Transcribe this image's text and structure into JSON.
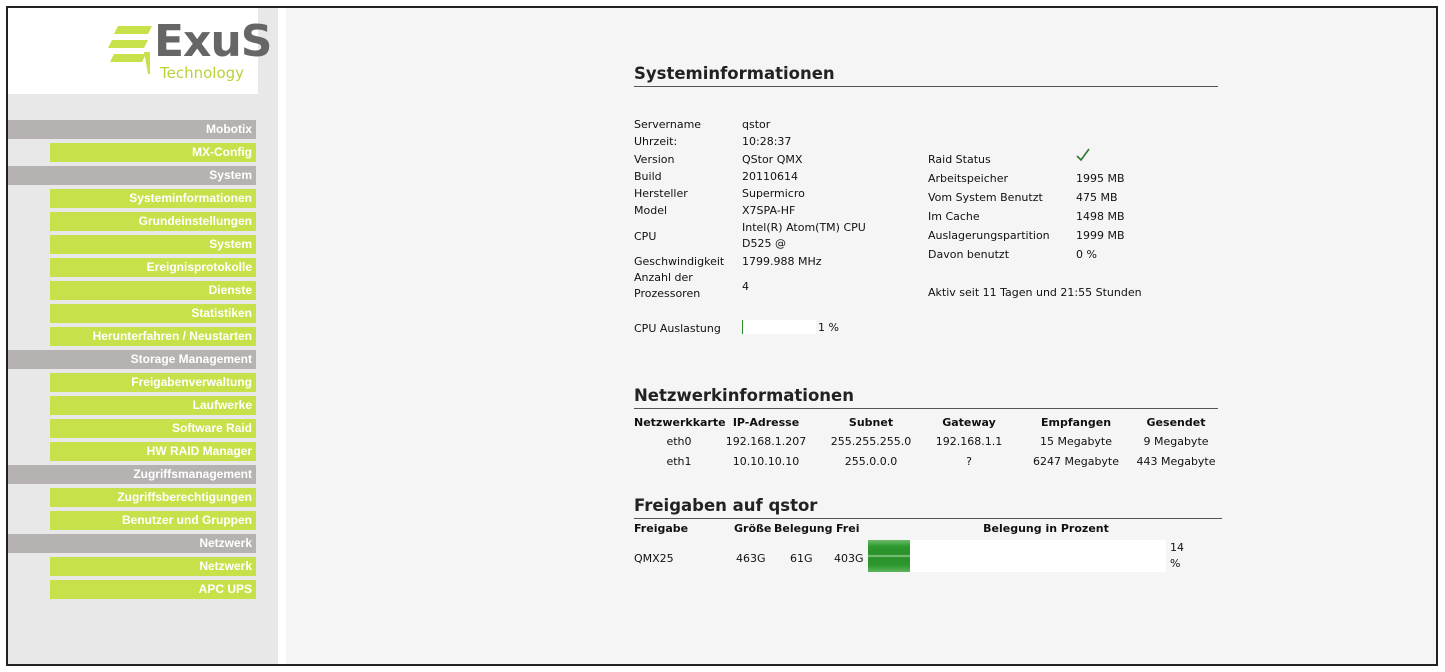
{
  "logo": {
    "word": "ExuS",
    "sub": "Technology",
    "brand_green": "#c7e14a",
    "brand_gray": "#666666"
  },
  "sidebar": {
    "groups": [
      {
        "header": "Mobotix",
        "items": [
          "MX-Config"
        ]
      },
      {
        "header": "System",
        "items": [
          "Systeminformationen",
          "Grundeinstellungen",
          "System",
          "Ereignisprotokolle",
          "Dienste",
          "Statistiken",
          "Herunterfahren / Neustarten"
        ]
      },
      {
        "header": "Storage Management",
        "items": [
          "Freigabenverwaltung",
          "Laufwerke",
          "Software Raid",
          "HW RAID Manager"
        ]
      },
      {
        "header": "Zugriffsmanagement",
        "items": [
          "Zugriffsberechtigungen",
          "Benutzer und Gruppen"
        ]
      },
      {
        "header": "Netzwerk",
        "items": [
          "Netzwerk",
          "APC UPS"
        ]
      }
    ]
  },
  "sysinfo": {
    "title": "Systeminformationen",
    "servername_label": "Servername",
    "servername": "qstor",
    "time_label": "Uhrzeit:",
    "time": "10:28:37",
    "version_label": "Version",
    "version": "QStor QMX",
    "build_label": "Build",
    "build": "20110614",
    "vendor_label": "Hersteller",
    "vendor": "Supermicro",
    "model_label": "Model",
    "model": "X7SPA-HF",
    "cpu_label": "CPU",
    "cpu": "Intel(R) Atom(TM) CPU D525 @",
    "speed_label": "Geschwindigkeit",
    "speed": "1799.988 MHz",
    "procs_label": "Anzahl der Prozessoren",
    "procs": "4",
    "raid_label": "Raid Status",
    "raid_icon": "checkmark-icon",
    "mem_label": "Arbeitspeicher",
    "mem": "1995 MB",
    "used_label": "Vom System Benutzt",
    "used": "475 MB",
    "cache_label": "Im Cache",
    "cache": "1498 MB",
    "swap_label": "Auslagerungspartition",
    "swap": "1999 MB",
    "swapused_label": "Davon benutzt",
    "swapused": "0 %",
    "uptime": "Aktiv seit 11 Tagen und 21:55 Stunden",
    "cpuload_label": "CPU Auslastung",
    "cpuload": "1 %",
    "cpuload_fraction": 0.01
  },
  "network": {
    "title": "Netzwerkinformationen",
    "headers": [
      "Netzwerkkarte",
      "IP-Adresse",
      "Subnet",
      "Gateway",
      "Empfangen",
      "Gesendet"
    ],
    "rows": [
      [
        "eth0",
        "192.168.1.207",
        "255.255.255.0",
        "192.168.1.1",
        "15 Megabyte",
        "9 Megabyte"
      ],
      [
        "eth1",
        "10.10.10.10",
        "255.0.0.0",
        "?",
        "6247 Megabyte",
        "443 Megabyte"
      ]
    ]
  },
  "shares": {
    "title": "Freigaben auf qstor",
    "headers": [
      "Freigabe",
      "Größe",
      "Belegung",
      "Frei",
      "Belegung in Prozent"
    ],
    "rows": [
      {
        "name": "QMX25",
        "size": "463G",
        "used": "61G",
        "free": "403G",
        "percent": "14 %",
        "fraction": 0.14
      }
    ]
  }
}
